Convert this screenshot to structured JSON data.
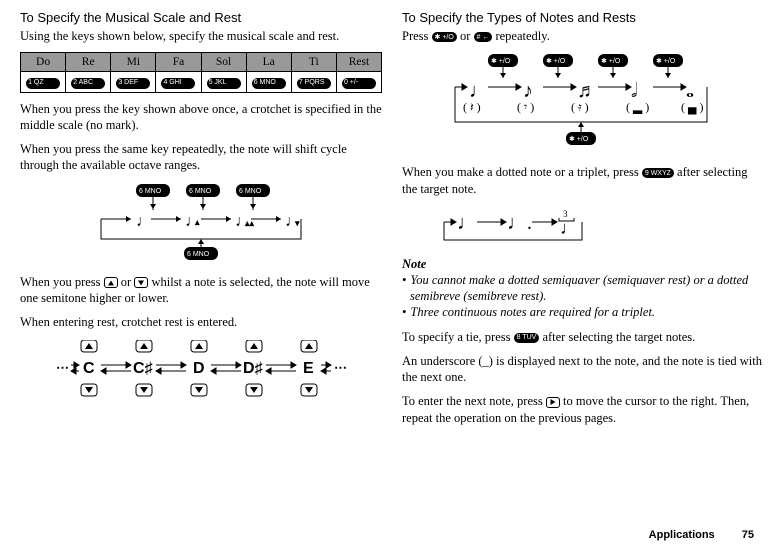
{
  "left": {
    "heading": "To Specify the Musical Scale and Rest",
    "intro": "Using the keys shown below, specify the musical scale and rest.",
    "scale": {
      "names": [
        "Do",
        "Re",
        "Mi",
        "Fa",
        "Sol",
        "La",
        "Ti",
        "Rest"
      ],
      "keys": [
        "1 QZ",
        "2 ABC",
        "3 DEF",
        "4 GHI",
        "5 JKL",
        "6 MNO",
        "7 PQRS",
        "0 +/-"
      ]
    },
    "p_crotchet": "When you press the key shown above once, a crotchet is specified in the middle scale (no mark).",
    "p_repeat": "When you press the same key repeatedly, the note will shift cycle through the available octave ranges.",
    "octave_key": "6 MNO",
    "p_semitone_a": "When you press",
    "p_semitone_b": "or",
    "p_semitone_c": "whilst a note is selected, the note will move one semitone higher or lower.",
    "p_rest": "When entering rest, crotchet rest is entered.",
    "semitone_labels": [
      "C",
      "C",
      "D",
      "D",
      "E"
    ]
  },
  "right": {
    "heading": "To Specify the Types of Notes and Rests",
    "p_press_a": "Press",
    "p_press_b": "or",
    "p_press_c": "repeatedly.",
    "star_key": "✱ +/O",
    "hash_key": "# ←",
    "p_dotted_a": "When you make a dotted note or a triplet, press",
    "p_dotted_b": "after selecting the target note.",
    "nine_key": "9 WXYZ",
    "note_heading": "Note",
    "note_items": [
      "You cannot make a dotted semiquaver (semiquaver rest) or a dotted semibreve (semibreve rest).",
      "Three continuous notes are required for a triplet."
    ],
    "p_tie_a": "To specify a tie, press",
    "p_tie_b": "after selecting the target notes.",
    "eight_key": "8 TUV",
    "p_underscore": "An underscore (_) is displayed next to the note, and the note is tied with the next one.",
    "p_next_a": "To enter the next note, press",
    "p_next_b": "to move the cursor to the right. Then, repeat the operation on the previous pages."
  },
  "footer": {
    "section": "Applications",
    "page": "75"
  }
}
